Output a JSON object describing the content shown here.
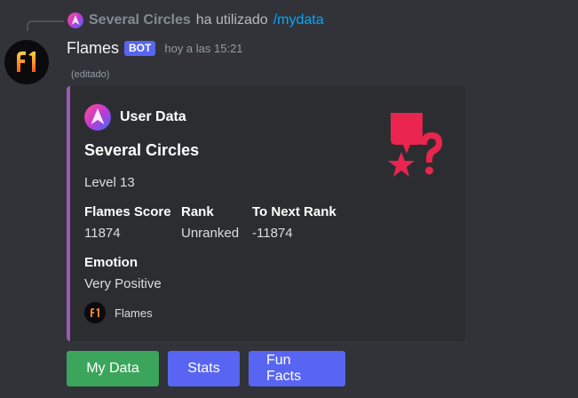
{
  "reply": {
    "username": "Several Circles",
    "action": "ha utilizado",
    "command": "/mydata",
    "avatar_icon": "several-circles-avatar-icon"
  },
  "message": {
    "author": "Flames",
    "bot_tag": "BOT",
    "timestamp": "hoy a las 15:21",
    "edited": "(editado)",
    "avatar_icon": "flames-logo-icon"
  },
  "embed": {
    "accent_color": "#9b59b6",
    "author_name": "User Data",
    "author_icon": "several-circles-avatar-icon",
    "title": "Several Circles",
    "description": "Level 13",
    "thumbnail_icon": "medal-question-icon",
    "fields": [
      {
        "name": "Flames Score",
        "value": "11874"
      },
      {
        "name": "Rank",
        "value": "Unranked"
      },
      {
        "name": "To Next Rank",
        "value": "-11874"
      },
      {
        "name": "Emotion",
        "value": "Very Positive"
      }
    ],
    "footer_text": "Flames",
    "footer_icon": "flames-logo-icon"
  },
  "buttons": [
    {
      "label": "My Data",
      "style": "success",
      "color": "#3ba55c"
    },
    {
      "label": "Stats",
      "style": "primary",
      "color": "#5865f2"
    },
    {
      "label": "Fun Facts",
      "style": "primary",
      "color": "#5865f2"
    }
  ]
}
